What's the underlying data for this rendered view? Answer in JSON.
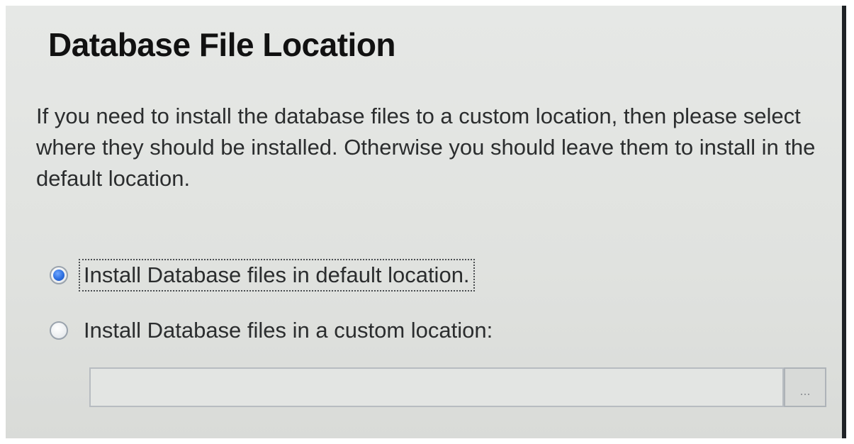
{
  "page": {
    "title": "Database File Location",
    "description": "If you need to install the database files to a custom location, then please select where they should be installed. Otherwise you should leave them to install in the default location."
  },
  "options": [
    {
      "label": "Install Database files in default location.",
      "selected": true
    },
    {
      "label": "Install Database files in a custom location:",
      "selected": false
    }
  ],
  "custom_path": {
    "value": "",
    "enabled": false
  },
  "browse_button": {
    "label": "..."
  },
  "colors": {
    "panel_bg": "#e0e2df",
    "radio_selected": "#2d6fe0",
    "text": "#2b2d2e",
    "title": "#111111"
  },
  "icons": {
    "radio_selected": "radio-selected-icon",
    "radio_unselected": "radio-unselected-icon"
  }
}
